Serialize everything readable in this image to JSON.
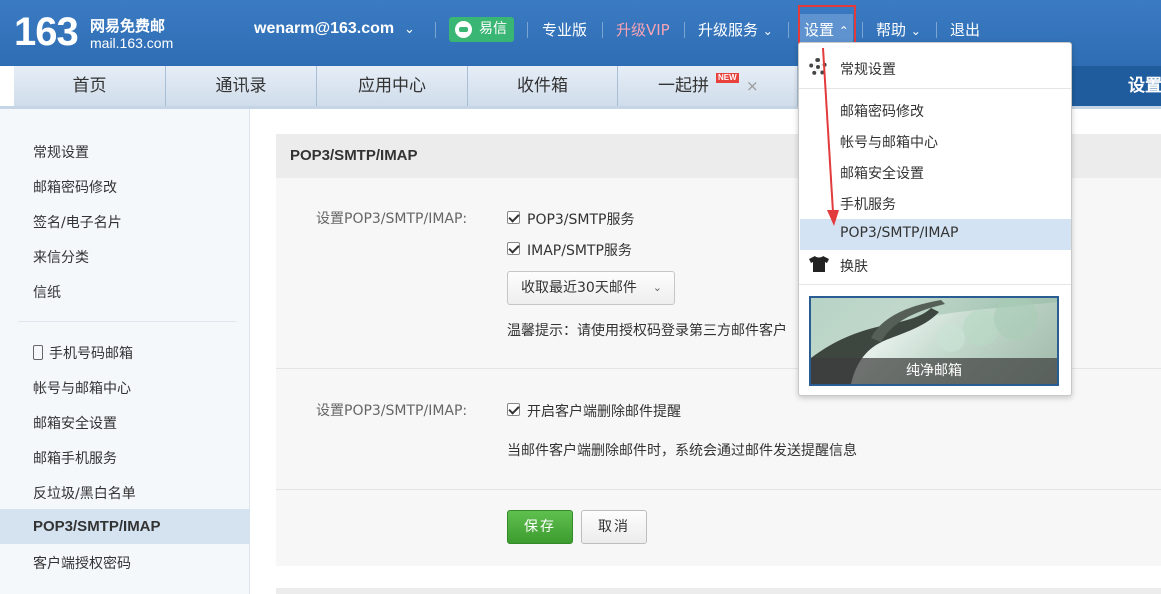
{
  "header": {
    "logo_number": "163",
    "logo_title": "网易免费邮",
    "logo_domain": "mail.163.com",
    "account": "wenarm@163.com",
    "yixin": "易信",
    "links": {
      "pro": "专业版",
      "vip": "升级VIP",
      "upgrade": "升级服务",
      "settings": "设置",
      "help": "帮助",
      "logout": "退出"
    }
  },
  "tabs": {
    "home": "首页",
    "contacts": "通讯录",
    "apps": "应用中心",
    "inbox": "收件箱",
    "pin": "一起拼",
    "pin_badge": "NEW",
    "close": "×",
    "settings": "设置"
  },
  "sidebar": {
    "items": [
      "常规设置",
      "邮箱密码修改",
      "签名/电子名片",
      "来信分类",
      "信纸",
      "手机号码邮箱",
      "帐号与邮箱中心",
      "邮箱安全设置",
      "邮箱手机服务",
      "反垃圾/黑白名单",
      "POP3/SMTP/IMAP",
      "客户端授权密码"
    ]
  },
  "main": {
    "section_title": "POP3/SMTP/IMAP",
    "row1_label": "设置POP3/SMTP/IMAP:",
    "opt_pop3": "POP3/SMTP服务",
    "opt_imap": "IMAP/SMTP服务",
    "select_value": "收取最近30天邮件",
    "tip": "温馨提示：请使用授权码登录第三方邮件客户",
    "row2_label": "设置POP3/SMTP/IMAP:",
    "opt_delete": "开启客户端删除邮件提醒",
    "desc": "当邮件客户端删除邮件时，系统会通过邮件发送提醒信息",
    "save": "保存",
    "cancel": "取消"
  },
  "dropdown": {
    "items": [
      "常规设置",
      "邮箱密码修改",
      "帐号与邮箱中心",
      "邮箱安全设置",
      "手机服务",
      "POP3/SMTP/IMAP",
      "换肤"
    ],
    "skin_caption": "纯净邮箱"
  },
  "colors": {
    "header_blue": "#2e6db3",
    "highlight_red": "#e23b3b",
    "save_green": "#3d9c2f",
    "yixin_green": "#39b574"
  }
}
